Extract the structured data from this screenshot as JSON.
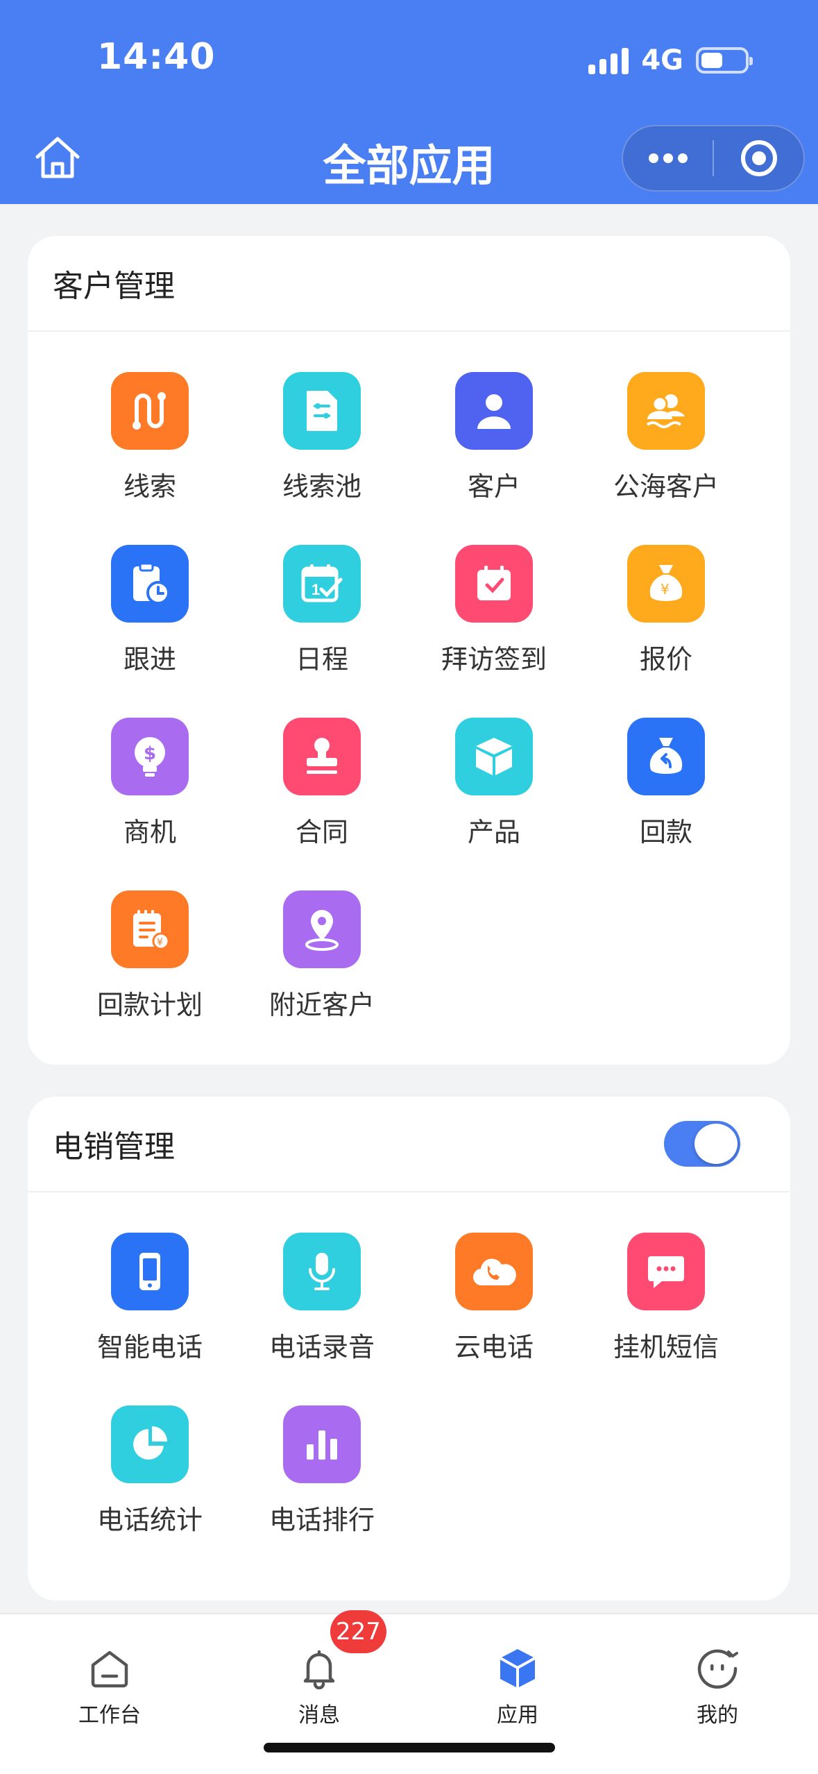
{
  "status_bar": {
    "time": "14:40",
    "network": "4G"
  },
  "header": {
    "title": "全部应用"
  },
  "customer_section": {
    "title": "客户管理",
    "apps": [
      {
        "label": "线索",
        "icon": "route-icon",
        "color": "#ff7a26"
      },
      {
        "label": "线索池",
        "icon": "document-settings-icon",
        "color": "#2fcfe0"
      },
      {
        "label": "客户",
        "icon": "person-icon",
        "color": "#4f63f0"
      },
      {
        "label": "公海客户",
        "icon": "people-wave-icon",
        "color": "#ffa91c"
      },
      {
        "label": "跟进",
        "icon": "clipboard-clock-icon",
        "color": "#2b73f6"
      },
      {
        "label": "日程",
        "icon": "calendar-check-icon",
        "color": "#2fcfe0"
      },
      {
        "label": "拜访签到",
        "icon": "calendar-heart-icon",
        "color": "#ff4a72"
      },
      {
        "label": "报价",
        "icon": "money-bag-yen-icon",
        "color": "#ffa91c"
      },
      {
        "label": "商机",
        "icon": "lightbulb-dollar-icon",
        "color": "#a96cf0"
      },
      {
        "label": "合同",
        "icon": "stamp-icon",
        "color": "#ff4a72"
      },
      {
        "label": "产品",
        "icon": "box-icon",
        "color": "#2fcfe0"
      },
      {
        "label": "回款",
        "icon": "money-bag-return-icon",
        "color": "#2b73f6"
      },
      {
        "label": "回款计划",
        "icon": "notepad-yen-icon",
        "color": "#ff7a26"
      },
      {
        "label": "附近客户",
        "icon": "location-pin-icon",
        "color": "#a96cf0"
      }
    ]
  },
  "telesales_section": {
    "title": "电销管理",
    "toggle_on": true,
    "apps": [
      {
        "label": "智能电话",
        "icon": "smartphone-icon",
        "color": "#2b73f6"
      },
      {
        "label": "电话录音",
        "icon": "microphone-icon",
        "color": "#2fcfe0"
      },
      {
        "label": "云电话",
        "icon": "cloud-phone-icon",
        "color": "#ff7a26"
      },
      {
        "label": "挂机短信",
        "icon": "chat-bubble-icon",
        "color": "#ff4a72"
      },
      {
        "label": "电话统计",
        "icon": "pie-chart-icon",
        "color": "#2fcfe0"
      },
      {
        "label": "电话排行",
        "icon": "bar-chart-icon",
        "color": "#a96cf0"
      }
    ]
  },
  "tabbar": {
    "tabs": [
      {
        "label": "工作台",
        "icon": "home-icon"
      },
      {
        "label": "消息",
        "icon": "bell-icon"
      },
      {
        "label": "应用",
        "icon": "cube-icon",
        "active": true
      },
      {
        "label": "我的",
        "icon": "smile-face-icon"
      }
    ],
    "message_badge": "227"
  },
  "colors": {
    "primary": "#4a7ef3",
    "badge": "#f03b3b"
  }
}
